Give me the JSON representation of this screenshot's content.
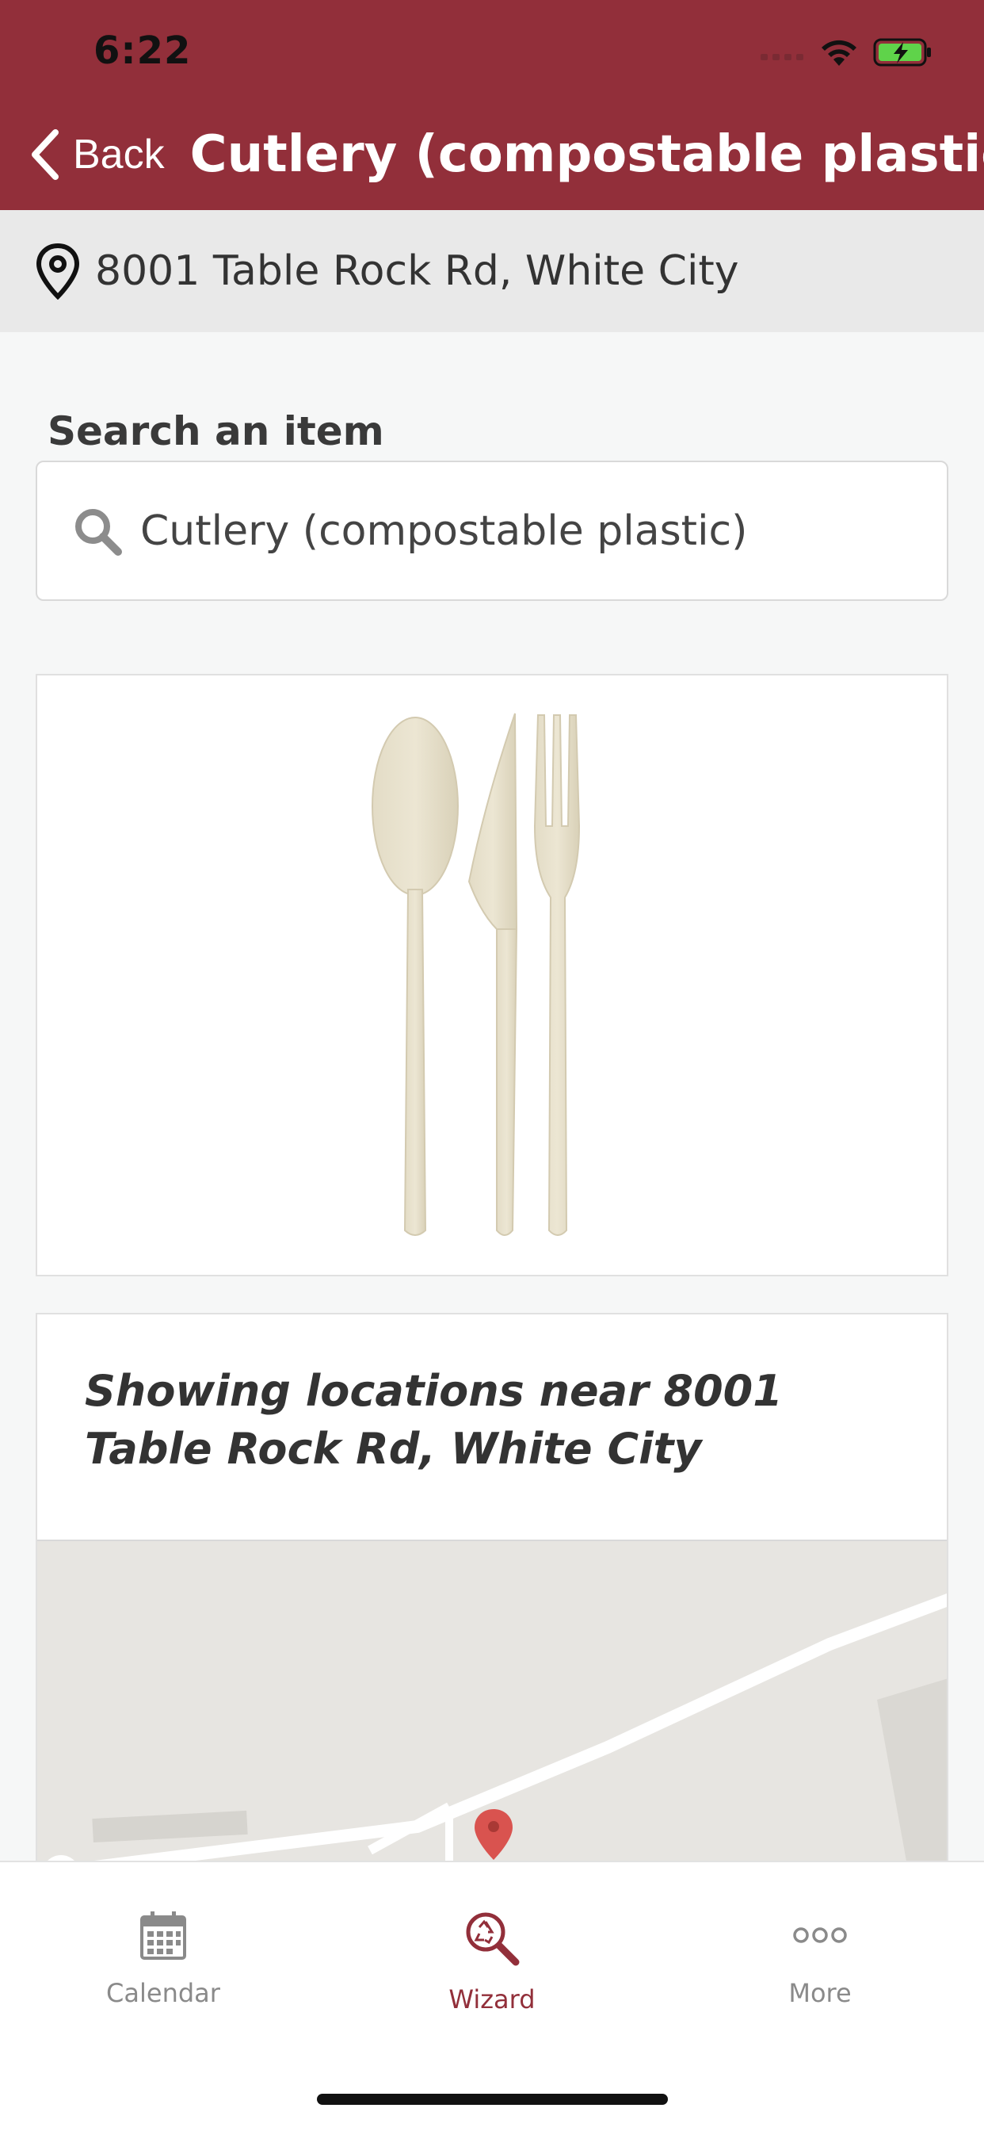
{
  "status_bar": {
    "time": "6:22",
    "icons": [
      "signal-icon",
      "wifi-icon",
      "battery-charging-icon"
    ]
  },
  "nav": {
    "back_label": "Back",
    "title": "Cutlery (compostable plastic)"
  },
  "location_bar": {
    "address": "8001 Table Rock Rd, White City",
    "icon": "location-pin-icon"
  },
  "search": {
    "label": "Search an item",
    "value": "Cutlery (compostable plastic)",
    "placeholder": "Search an item"
  },
  "item_image": {
    "depicts": [
      "spoon",
      "knife",
      "fork"
    ]
  },
  "locations": {
    "title": "Showing locations near 8001 Table Rock Rd, White City"
  },
  "tabs": [
    {
      "label": "Calendar",
      "icon": "calendar-icon",
      "active": false
    },
    {
      "label": "Wizard",
      "icon": "recycle-search-icon",
      "active": true
    },
    {
      "label": "More",
      "icon": "more-dots-icon",
      "active": false
    }
  ],
  "colors": {
    "brand": "#922f3a",
    "location_bar": "#e9e9e9",
    "map_pin": "#d9534f",
    "battery": "#5fd34a"
  }
}
